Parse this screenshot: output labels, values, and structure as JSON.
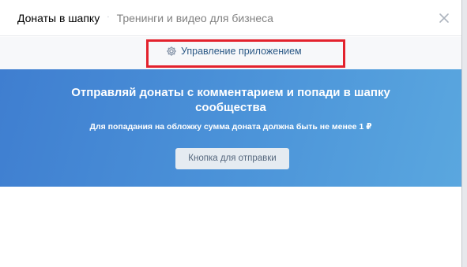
{
  "header": {
    "title": "Донаты в шапку",
    "separator": "·",
    "subtitle": "Тренинги и видео для бизнеса",
    "close_icon": "close-icon"
  },
  "manage": {
    "icon": "gear-icon",
    "label": "Управление приложением",
    "highlight_color": "#e3222d"
  },
  "banner": {
    "title_line1": "Отправляй донаты с комментарием и попади в шапку",
    "title_line2": "сообщества",
    "subtitle": "Для попадания на обложку сумма доната должна быть не менее 1 ₽",
    "button_label": "Кнопка для отправки",
    "gradient_colors": [
      "#3f7ed0",
      "#5aa7df"
    ]
  }
}
